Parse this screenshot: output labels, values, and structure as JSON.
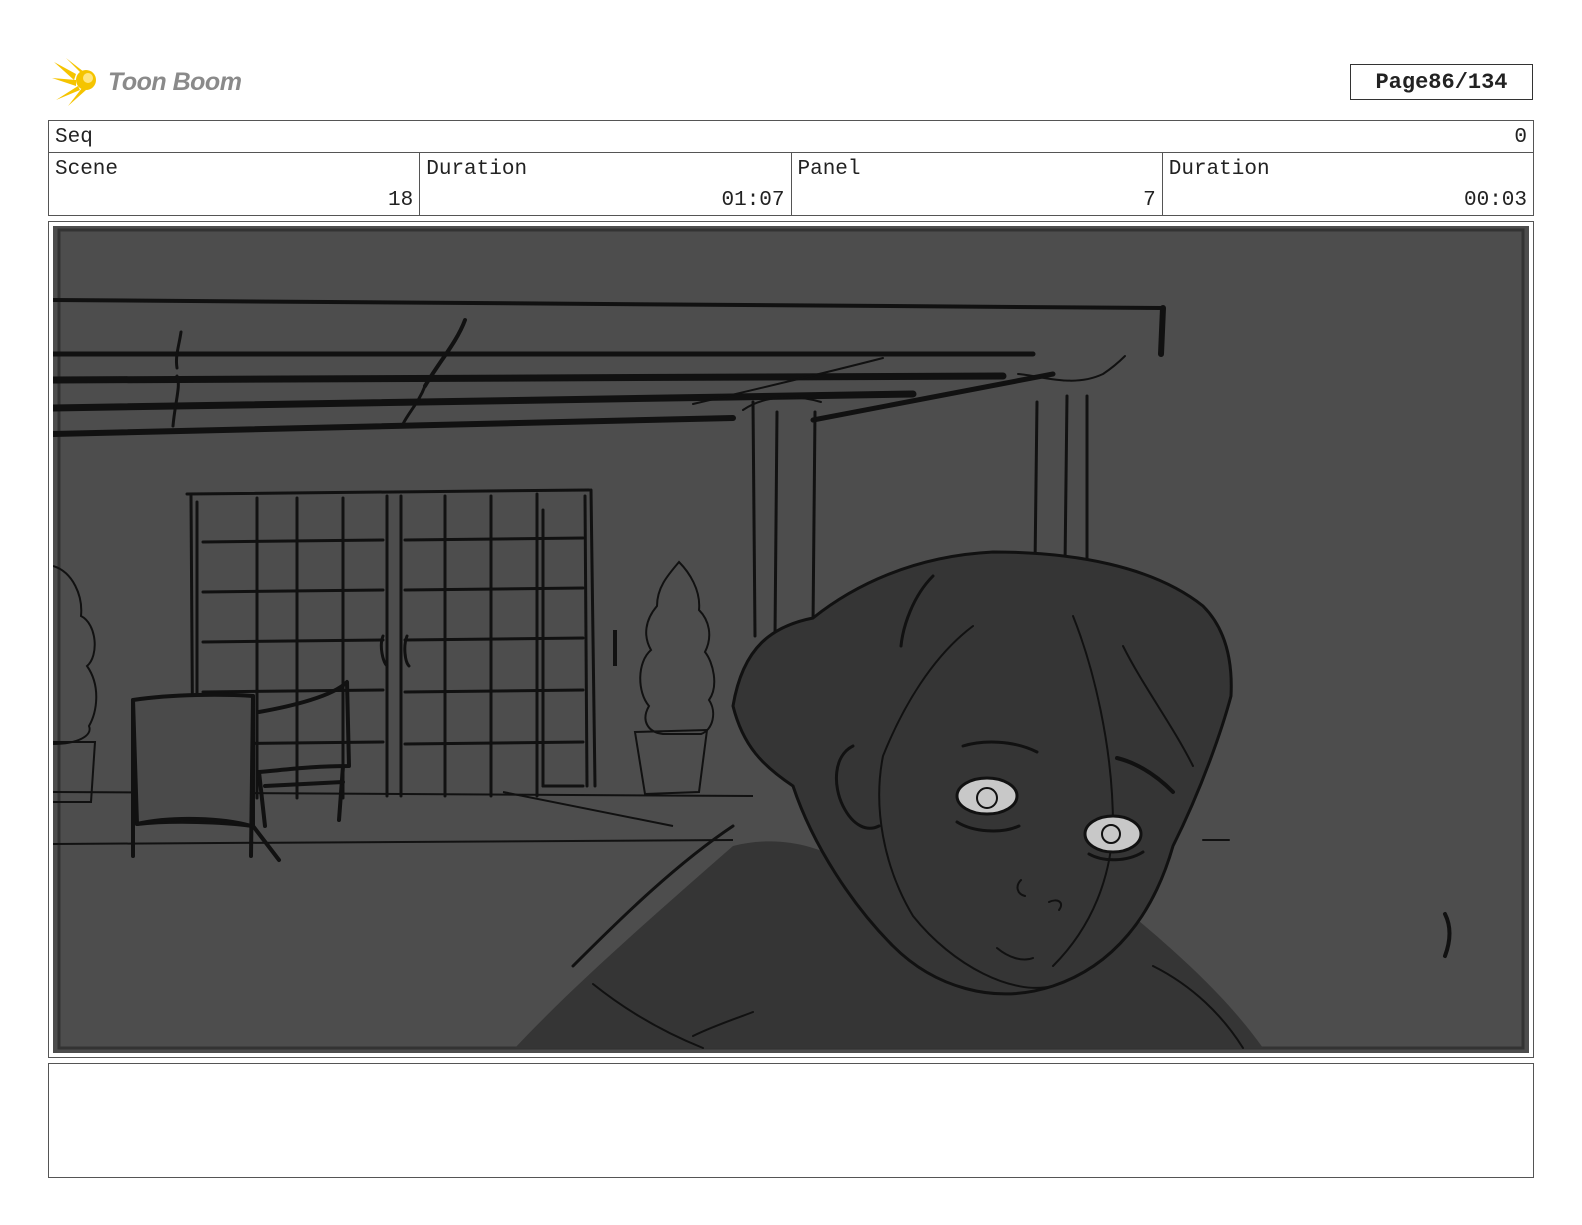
{
  "header": {
    "logo_text": "Toon Boom",
    "page_label": "Page",
    "page_number": "86/134"
  },
  "seq": {
    "label": "Seq",
    "value": "0"
  },
  "fields": [
    {
      "label": "Scene",
      "value": "18"
    },
    {
      "label": "Duration",
      "value": "01:07"
    },
    {
      "label": "Panel",
      "value": "7"
    },
    {
      "label": "Duration",
      "value": "00:03"
    }
  ],
  "panel": {
    "background_color": "#4d4d4d",
    "figure_color": "#353535",
    "line_color": "#111111",
    "icon": "storyboard-sketch-image"
  },
  "notes": {
    "text": ""
  }
}
